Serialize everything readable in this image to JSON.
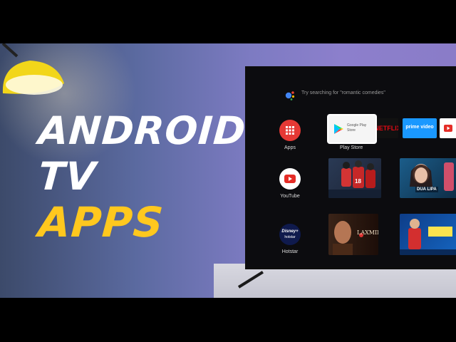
{
  "headline": {
    "line1": "ANDROID",
    "line2": "TV",
    "line3": "APPS"
  },
  "tv": {
    "search_hint": "Try searching for \"romantic comedies\"",
    "side_apps": [
      {
        "label": "Apps",
        "icon": "grid-icon"
      },
      {
        "label": "YouTube",
        "icon": "youtube-icon"
      },
      {
        "label": "Hotstar",
        "icon": "disney-hotstar-icon"
      }
    ],
    "row1": {
      "selected_label": "Play Store",
      "play_tile_text": "Google Play\nStore",
      "netflix": "NETFLIX",
      "prime": "prime video"
    },
    "row2": {
      "badge": "DUA LIPA",
      "jersey": "18"
    },
    "row3": {
      "movie": "LAXMII"
    },
    "disney_logo": "Disney+",
    "hotstar_text": "hotstar"
  },
  "colors": {
    "accent_yellow": "#ffc81e",
    "apps_red": "#e53935",
    "netflix_red": "#e50914",
    "prime_blue": "#1a98ff"
  }
}
